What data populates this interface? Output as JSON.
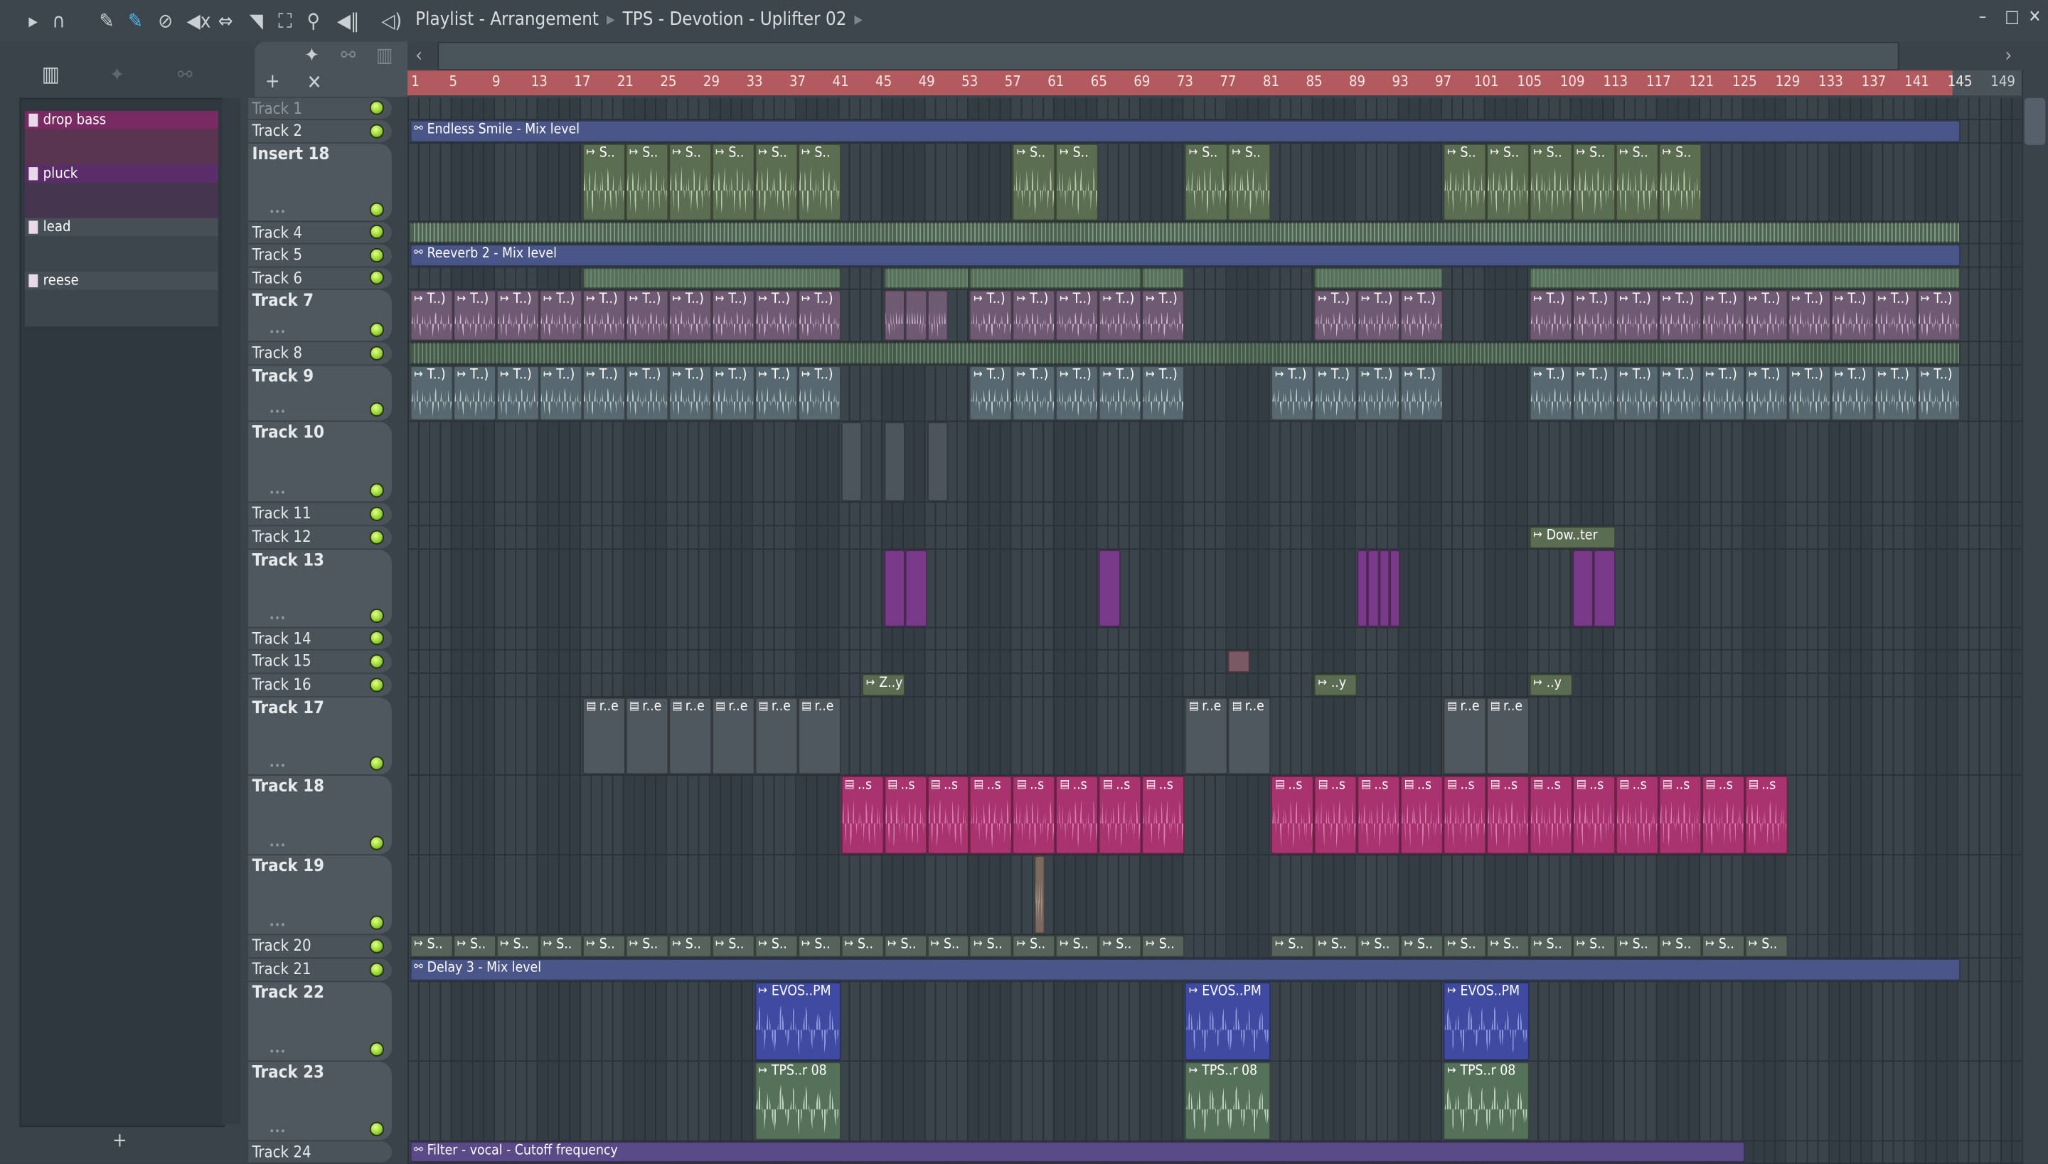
{
  "toolbar": {
    "title": "Playlist - Arrangement",
    "pattern": "TPS - Devotion - Uplifter 02",
    "icons": [
      "play-arrow-icon",
      "magnet-icon",
      "pencil-icon",
      "paint-brush-icon",
      "delete-icon",
      "mute-icon",
      "slip-icon",
      "slice-icon",
      "select-icon",
      "zoom-icon",
      "playback-icon",
      "speaker-icon"
    ]
  },
  "patterns": [
    {
      "name": "drop bass",
      "color": "#7a2a62",
      "body": "#5a3550"
    },
    {
      "name": "pluck",
      "color": "#5a2c6a",
      "body": "#45354f"
    },
    {
      "name": "lead",
      "color": "#474f56",
      "body": "#3e464d"
    },
    {
      "name": "reese",
      "color": "#474f56",
      "body": "#3e464d"
    }
  ],
  "add_label": "+",
  "ruler": {
    "labels": [
      1,
      5,
      9,
      13,
      17,
      21,
      25,
      29,
      33,
      37,
      41,
      45,
      49,
      53,
      57,
      61,
      65,
      69,
      73,
      77,
      81,
      85,
      89,
      93,
      97,
      101,
      105,
      109,
      113,
      117,
      121,
      125,
      129,
      133,
      137,
      141,
      145,
      149
    ]
  },
  "tracks": [
    "Track 1",
    "Track 2",
    "Insert 18",
    "Track 4",
    "Track 5",
    "Track 6",
    "Track 7",
    "Track 8",
    "Track 9",
    "Track 10",
    "Track 11",
    "Track 12",
    "Track 13",
    "Track 14",
    "Track 15",
    "Track 16",
    "Track 17",
    "Track 18",
    "Track 19",
    "Track 20",
    "Track 21",
    "Track 22",
    "Track 23",
    "Track 24"
  ],
  "clips": [
    {
      "track": 1,
      "start": 1,
      "len": 144,
      "count": 1,
      "label": "Endless Smile - Mix level",
      "kind": "auto",
      "color": "#4b5688"
    },
    {
      "track": 2,
      "start": 17,
      "len": 4,
      "count": 6,
      "label": "S..",
      "kind": "audio",
      "color": "#5c6e52",
      "wave": "#c9dcb8"
    },
    {
      "track": 2,
      "start": 57,
      "len": 4,
      "count": 2,
      "label": "S..",
      "kind": "audio",
      "color": "#5c6e52",
      "wave": "#c9dcb8"
    },
    {
      "track": 2,
      "start": 73,
      "len": 4,
      "count": 2,
      "label": "S..",
      "kind": "audio",
      "color": "#5c6e52",
      "wave": "#c9dcb8"
    },
    {
      "track": 2,
      "start": 97,
      "len": 4,
      "count": 6,
      "label": "S..",
      "kind": "audio",
      "color": "#5c6e52",
      "wave": "#c9dcb8"
    },
    {
      "track": 3,
      "start": 1,
      "len": 144,
      "count": 1,
      "label": "",
      "kind": "plain",
      "color": "#4e6152",
      "wave": "#7f9a80"
    },
    {
      "track": 4,
      "start": 1,
      "len": 144,
      "count": 1,
      "label": "Reeverb 2 - Mix level",
      "kind": "auto",
      "color": "#4b5688"
    },
    {
      "track": 5,
      "start": 17,
      "len": 24,
      "count": 1,
      "label": "",
      "kind": "plain",
      "color": "#56705a"
    },
    {
      "track": 5,
      "start": 45,
      "len": 8,
      "count": 1,
      "label": "",
      "kind": "plain",
      "color": "#56705a"
    },
    {
      "track": 5,
      "start": 53,
      "len": 16,
      "count": 1,
      "label": "",
      "kind": "plain",
      "color": "#56705a"
    },
    {
      "track": 5,
      "start": 69,
      "len": 4,
      "count": 1,
      "label": "",
      "kind": "plain",
      "color": "#56705a"
    },
    {
      "track": 5,
      "start": 85,
      "len": 12,
      "count": 1,
      "label": "",
      "kind": "plain",
      "color": "#56705a"
    },
    {
      "track": 5,
      "start": 105,
      "len": 40,
      "count": 1,
      "label": "",
      "kind": "plain",
      "color": "#56705a"
    },
    {
      "track": 6,
      "start": 1,
      "len": 4,
      "count": 10,
      "label": "T..)",
      "kind": "audio",
      "color": "#6e5a72",
      "wave": "#e4c6e6"
    },
    {
      "track": 6,
      "start": 45,
      "len": 2,
      "count": 3,
      "label": "",
      "kind": "audio",
      "color": "#6e5a72",
      "wave": "#e4c6e6"
    },
    {
      "track": 6,
      "start": 53,
      "len": 4,
      "count": 4,
      "label": "T..)",
      "kind": "audio",
      "color": "#6e5a72",
      "wave": "#e4c6e6"
    },
    {
      "track": 6,
      "start": 69,
      "len": 4,
      "count": 1,
      "label": "T..)",
      "kind": "audio",
      "color": "#6e5a72",
      "wave": "#e4c6e6"
    },
    {
      "track": 6,
      "start": 85,
      "len": 4,
      "count": 3,
      "label": "T..)",
      "kind": "audio",
      "color": "#6e5a72",
      "wave": "#e4c6e6"
    },
    {
      "track": 6,
      "start": 105,
      "len": 4,
      "count": 10,
      "label": "T..)",
      "kind": "audio",
      "color": "#6e5a72",
      "wave": "#e4c6e6"
    },
    {
      "track": 7,
      "start": 1,
      "len": 144,
      "count": 1,
      "label": "",
      "kind": "plain",
      "color": "#465a4c"
    },
    {
      "track": 8,
      "start": 1,
      "len": 4,
      "count": 10,
      "label": "T..)",
      "kind": "audio",
      "color": "#586870",
      "wave": "#cfdbe0"
    },
    {
      "track": 8,
      "start": 53,
      "len": 4,
      "count": 5,
      "label": "T..)",
      "kind": "audio",
      "color": "#586870",
      "wave": "#cfdbe0"
    },
    {
      "track": 8,
      "start": 81,
      "len": 4,
      "count": 4,
      "label": "T..)",
      "kind": "audio",
      "color": "#586870",
      "wave": "#cfdbe0"
    },
    {
      "track": 8,
      "start": 105,
      "len": 4,
      "count": 10,
      "label": "T..)",
      "kind": "audio",
      "color": "#586870",
      "wave": "#cfdbe0"
    },
    {
      "track": 9,
      "start": 41,
      "len": 2,
      "count": 1,
      "label": "",
      "kind": "pat",
      "color": "#4c555c"
    },
    {
      "track": 9,
      "start": 45,
      "len": 2,
      "count": 1,
      "label": "",
      "kind": "pat",
      "color": "#4c555c"
    },
    {
      "track": 9,
      "start": 49,
      "len": 2,
      "count": 1,
      "label": "",
      "kind": "pat",
      "color": "#4c555c"
    },
    {
      "track": 11,
      "start": 105,
      "len": 8,
      "count": 1,
      "label": "Dow..ter",
      "kind": "audio",
      "color": "#5a6c52"
    },
    {
      "track": 12,
      "start": 45,
      "len": 2,
      "count": 2,
      "label": "",
      "kind": "pat",
      "color": "#7a3a8a"
    },
    {
      "track": 12,
      "start": 65,
      "len": 2,
      "count": 1,
      "label": "",
      "kind": "pat",
      "color": "#7a3a8a"
    },
    {
      "track": 12,
      "start": 89,
      "len": 1,
      "count": 4,
      "label": "",
      "kind": "pat",
      "color": "#7a3a8a"
    },
    {
      "track": 12,
      "start": 109,
      "len": 2,
      "count": 2,
      "label": "",
      "kind": "pat",
      "color": "#7a3a8a"
    },
    {
      "track": 14,
      "start": 77,
      "len": 2,
      "count": 1,
      "label": "",
      "kind": "audio",
      "color": "#7a5864"
    },
    {
      "track": 15,
      "start": 43,
      "len": 4,
      "count": 1,
      "label": "Z..y",
      "kind": "audio",
      "color": "#5a6c52"
    },
    {
      "track": 15,
      "start": 85,
      "len": 4,
      "count": 1,
      "label": "..y",
      "kind": "audio",
      "color": "#5a6c52"
    },
    {
      "track": 15,
      "start": 105,
      "len": 4,
      "count": 1,
      "label": "..y",
      "kind": "audio",
      "color": "#5a6c52"
    },
    {
      "track": 16,
      "start": 17,
      "len": 4,
      "count": 6,
      "label": "r..e",
      "kind": "pat",
      "color": "#4f585f"
    },
    {
      "track": 16,
      "start": 73,
      "len": 4,
      "count": 2,
      "label": "r..e",
      "kind": "pat",
      "color": "#4f585f"
    },
    {
      "track": 16,
      "start": 97,
      "len": 4,
      "count": 2,
      "label": "r..e",
      "kind": "pat",
      "color": "#4f585f"
    },
    {
      "track": 17,
      "start": 41,
      "len": 4,
      "count": 8,
      "label": "..s",
      "kind": "pat",
      "color": "#a8336e",
      "wave": "#e08ac0"
    },
    {
      "track": 17,
      "start": 81,
      "len": 4,
      "count": 12,
      "label": "..s",
      "kind": "pat",
      "color": "#a8336e",
      "wave": "#e08ac0"
    },
    {
      "track": 18,
      "start": 59,
      "len": 1,
      "count": 1,
      "label": "",
      "kind": "audio",
      "color": "#7a6a60",
      "wave": "#d8c8c0"
    },
    {
      "track": 19,
      "start": 1,
      "len": 4,
      "count": 10,
      "label": "S..",
      "kind": "audio",
      "color": "#55635a"
    },
    {
      "track": 19,
      "start": 41,
      "len": 4,
      "count": 8,
      "label": "S..",
      "kind": "audio",
      "color": "#55635a"
    },
    {
      "track": 19,
      "start": 81,
      "len": 4,
      "count": 12,
      "label": "S..",
      "kind": "audio",
      "color": "#55635a"
    },
    {
      "track": 20,
      "start": 1,
      "len": 144,
      "count": 1,
      "label": "Delay 3 - Mix level",
      "kind": "auto",
      "color": "#4b5688"
    },
    {
      "track": 21,
      "start": 33,
      "len": 8,
      "count": 1,
      "label": "EVOS..PM",
      "kind": "audio",
      "color": "#3f4aa0",
      "wave": "#9aa8e8"
    },
    {
      "track": 21,
      "start": 73,
      "len": 8,
      "count": 1,
      "label": "EVOS..PM",
      "kind": "audio",
      "color": "#3f4aa0",
      "wave": "#9aa8e8"
    },
    {
      "track": 21,
      "start": 97,
      "len": 8,
      "count": 1,
      "label": "EVOS..PM",
      "kind": "audio",
      "color": "#3f4aa0",
      "wave": "#9aa8e8"
    },
    {
      "track": 22,
      "start": 33,
      "len": 8,
      "count": 1,
      "label": "TPS..r 08",
      "kind": "audio",
      "color": "#55715a",
      "wave": "#cfe8cc"
    },
    {
      "track": 22,
      "start": 73,
      "len": 8,
      "count": 1,
      "label": "TPS..r 08",
      "kind": "audio",
      "color": "#55715a",
      "wave": "#cfe8cc"
    },
    {
      "track": 22,
      "start": 97,
      "len": 8,
      "count": 1,
      "label": "TPS..r 08",
      "kind": "audio",
      "color": "#55715a",
      "wave": "#cfe8cc"
    },
    {
      "track": 23,
      "start": 1,
      "len": 124,
      "count": 1,
      "label": "Filter - vocal - Cutoff frequency",
      "kind": "auto",
      "color": "#5a4a88"
    }
  ]
}
